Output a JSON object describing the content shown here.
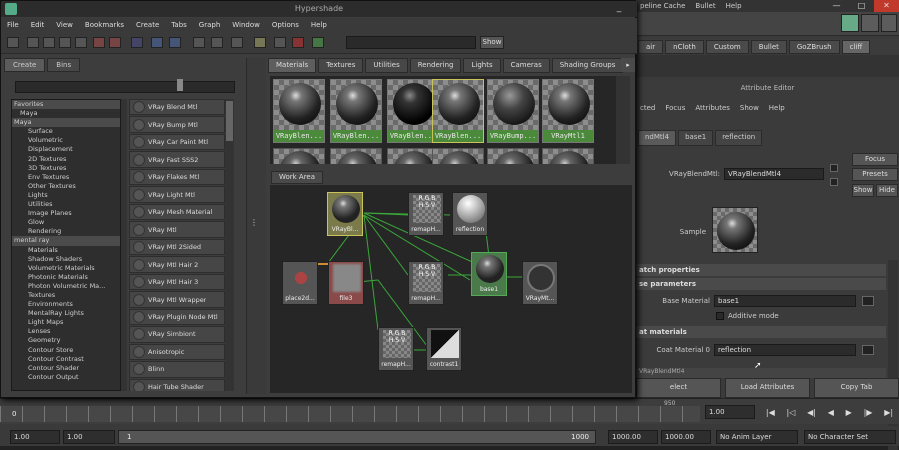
{
  "maya": {
    "menubar": [
      "peline Cache",
      "Bullet",
      "Help"
    ],
    "shelf_tabs": [
      "air",
      "nCloth",
      "Custom",
      "Bullet",
      "GoZBrush",
      "cliff"
    ],
    "shelf_active": "cliff",
    "window_controls": {
      "minimize": "—",
      "maximize": "□",
      "close": "✕"
    }
  },
  "hypershade": {
    "title": "Hypershade",
    "minimize": "_",
    "menu": [
      "File",
      "Edit",
      "View",
      "Bookmarks",
      "Create",
      "Tabs",
      "Graph",
      "Window",
      "Options",
      "Help"
    ],
    "show_button": "Show",
    "left_tabs": [
      "Create",
      "Bins"
    ],
    "tree": [
      {
        "label": "Favorites",
        "type": "hdr"
      },
      {
        "label": "Maya",
        "type": "sub2"
      },
      {
        "label": "Maya",
        "type": "hdr"
      },
      {
        "label": "Surface",
        "type": "sub"
      },
      {
        "label": "Volumetric",
        "type": "sub"
      },
      {
        "label": "Displacement",
        "type": "sub"
      },
      {
        "label": "2D Textures",
        "type": "sub"
      },
      {
        "label": "3D Textures",
        "type": "sub"
      },
      {
        "label": "Env Textures",
        "type": "sub"
      },
      {
        "label": "Other Textures",
        "type": "sub"
      },
      {
        "label": "Lights",
        "type": "sub"
      },
      {
        "label": "Utilities",
        "type": "sub"
      },
      {
        "label": "Image Planes",
        "type": "sub"
      },
      {
        "label": "Glow",
        "type": "sub"
      },
      {
        "label": "Rendering",
        "type": "sub"
      },
      {
        "label": "mental ray",
        "type": "hdr"
      },
      {
        "label": "Materials",
        "type": "sub"
      },
      {
        "label": "Shadow Shaders",
        "type": "sub"
      },
      {
        "label": "Volumetric Materials",
        "type": "sub"
      },
      {
        "label": "Photonic Materials",
        "type": "sub"
      },
      {
        "label": "Photon Volumetric Ma...",
        "type": "sub"
      },
      {
        "label": "Textures",
        "type": "sub"
      },
      {
        "label": "Environments",
        "type": "sub"
      },
      {
        "label": "MentalRay Lights",
        "type": "sub"
      },
      {
        "label": "Light Maps",
        "type": "sub"
      },
      {
        "label": "Lenses",
        "type": "sub"
      },
      {
        "label": "Geometry",
        "type": "sub"
      },
      {
        "label": "Contour Store",
        "type": "sub"
      },
      {
        "label": "Contour Contrast",
        "type": "sub"
      },
      {
        "label": "Contour Shader",
        "type": "sub"
      },
      {
        "label": "Contour Output",
        "type": "sub"
      }
    ],
    "nodes": [
      "VRay Blend Mtl",
      "VRay Bump Mtl",
      "VRay Car Paint Mtl",
      "VRay Fast SSS2",
      "VRay Flakes Mtl",
      "VRay Light Mtl",
      "VRay Mesh Material",
      "VRay Mtl",
      "VRay Mtl 2Sided",
      "VRay Mtl Hair 2",
      "VRay Mtl Hair 3",
      "VRay Mtl Wrapper",
      "VRay Plugin Node Mtl",
      "VRay Simbiont",
      "Anisotropic",
      "Blinn",
      "Hair Tube Shader"
    ],
    "material_tabs": [
      "Materials",
      "Textures",
      "Utilities",
      "Rendering",
      "Lights",
      "Cameras",
      "Shading Groups"
    ],
    "material_tab_active": "Materials",
    "tab_arrow": "▸",
    "swatches": [
      "VRayBlen...",
      "VRayBlen...",
      "VRayBlen...",
      "VRayBlen...",
      "VRayBump...",
      "VRayMtl1"
    ],
    "work_area_tab": "Work Area",
    "graph_nodes": {
      "n1": "VRayBl...",
      "n2": "remapH...",
      "n3": "reflection",
      "n4": "place2d...",
      "n5": "file3",
      "n6": "remapH...",
      "n7": "base1",
      "n8": "VRayMt...",
      "n9": "remapH...",
      "n10": "contrast1"
    },
    "rgb_text": "R G B\nH S V"
  },
  "attribute_editor": {
    "title": "Attribute Editor",
    "menu": [
      "cted",
      "Focus",
      "Attributes",
      "Show",
      "Help"
    ],
    "tabs": [
      "ndMtl4",
      "base1",
      "reflection"
    ],
    "node_label": "VRayBlendMtl:",
    "node_value": "VRayBlendMtl4",
    "buttons": [
      "Focus",
      "Presets",
      "Show",
      "Hide"
    ],
    "sample_label": "Sample",
    "sections": [
      "atch properties",
      "se parameters",
      "at materials",
      "VRayBlendMtl4"
    ],
    "base_material_label": "Base Material",
    "base_material_value": "base1",
    "additive_label": "Additive mode",
    "coat_label": "Coat Material 0",
    "coat_value": "reflection",
    "bottom": [
      "elect",
      "Load Attributes",
      "Copy Tab"
    ]
  },
  "time": {
    "frame": "0",
    "ruler_label": "950",
    "current": "1.00",
    "start": "1.00",
    "inner_start": "1.00",
    "slider_value": "1",
    "slider_end": "1000",
    "end": "1000.00",
    "end2": "1000.00",
    "anim_layer": "No Anim Layer",
    "char_set": "No Character Set"
  }
}
